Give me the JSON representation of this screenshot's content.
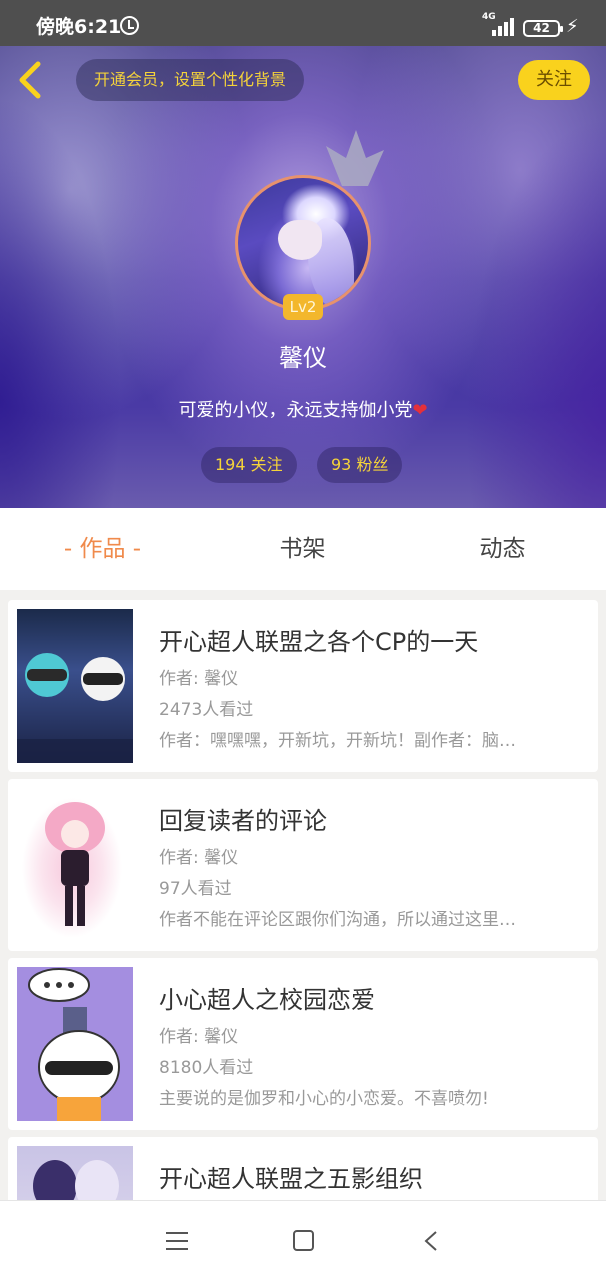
{
  "status_bar": {
    "time": "傍晚6:21",
    "network": "4G",
    "battery": "42"
  },
  "header": {
    "member_prompt": "开通会员，设置个性化背景",
    "follow_label": "关注",
    "level": "Lv2",
    "username": "馨仪",
    "bio": "可爱的小仪，永远支持伽小党",
    "bio_emoji": "❤",
    "stats": {
      "following": "194 关注",
      "fans": "93 粉丝"
    }
  },
  "tabs": [
    {
      "label": "- 作品 -",
      "active": true
    },
    {
      "label": "书架",
      "active": false
    },
    {
      "label": "动态",
      "active": false
    }
  ],
  "works": [
    {
      "title": "开心超人联盟之各个CP的一天",
      "author": "作者: 馨仪",
      "views": "2473人看过",
      "desc": "作者：嘿嘿嘿，开新坑，开新坑！副作者：脑…"
    },
    {
      "title": "回复读者的评论",
      "author": "作者: 馨仪",
      "views": "97人看过",
      "desc": "作者不能在评论区跟你们沟通，所以通过这里…"
    },
    {
      "title": "小心超人之校园恋爱",
      "author": "作者: 馨仪",
      "views": "8180人看过",
      "desc": "主要说的是伽罗和小心的小恋爱。不喜喷勿!"
    },
    {
      "title": "开心超人联盟之五影组织",
      "author": "",
      "views": "",
      "desc": ""
    }
  ],
  "colors": {
    "accent": "#f08a4b",
    "follow_button": "#f9d21d",
    "gold_text": "#f5d33a"
  },
  "icons": [
    "back-arrow-icon",
    "crown-icon",
    "alarm-icon",
    "signal-icon",
    "battery-icon",
    "menu-icon",
    "home-icon",
    "nav-back-icon"
  ]
}
